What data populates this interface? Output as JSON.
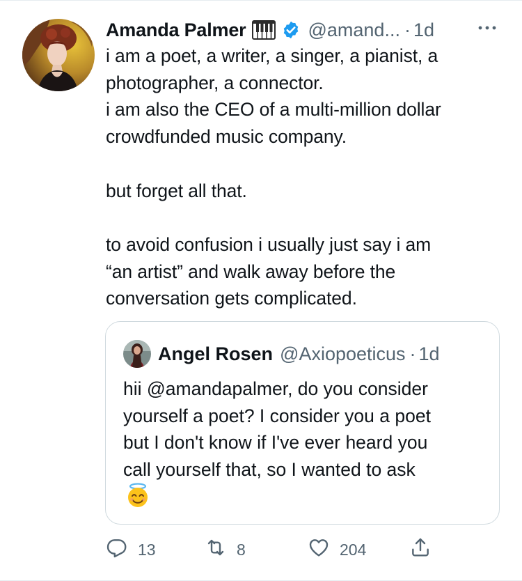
{
  "tweet": {
    "author_name": "Amanda Palmer",
    "author_handle": "@amand...",
    "separator": "·",
    "time": "1d",
    "text": "i am a poet, a writer, a singer, a pianist, a\nphotographer, a connector.\ni am also the CEO of a multi-million dollar\ncrowdfunded music company.\n\nbut forget all that.\n\nto avoid confusion i usually just say i am\n“an artist” and walk away before the\nconversation gets complicated.",
    "icons": [
      "avatar",
      "piano-emoji-icon",
      "verified-badge-icon",
      "more-options-icon"
    ]
  },
  "quoted_tweet": {
    "author_name": "Angel Rosen",
    "author_handle": "@Axiopoeticus",
    "separator": "·",
    "time": "1d",
    "text": "hii @amandapalmer, do you consider\nyourself a poet? I consider you a poet\nbut I don't know if I've ever heard you\ncall yourself that, so I wanted to ask",
    "emoji": "smiling-face-with-halo-emoji"
  },
  "actions": {
    "reply_count": "13",
    "retweet_count": "8",
    "like_count": "204",
    "icons": [
      "reply-icon",
      "retweet-icon",
      "like-icon",
      "share-icon"
    ]
  },
  "colors": {
    "text_primary": "#0f1419",
    "text_secondary": "#536471",
    "verified_blue": "#1d9bf0",
    "border": "#cfd9de"
  }
}
